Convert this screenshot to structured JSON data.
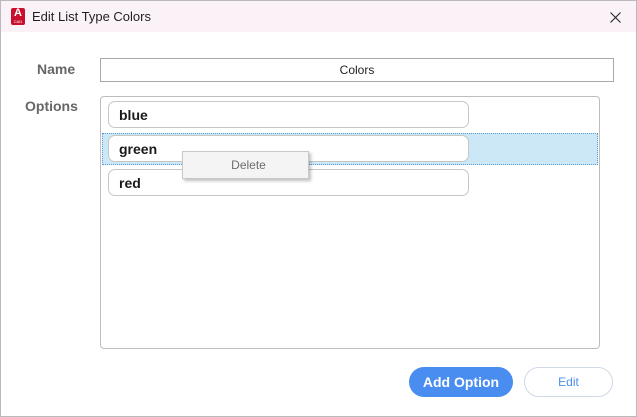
{
  "window": {
    "title": "Edit List Type Colors",
    "app_icon_letter": "A",
    "app_icon_sub": "CAD",
    "accent_color": "#c8102e"
  },
  "form": {
    "name_label": "Name",
    "name_value": "Colors",
    "options_label": "Options"
  },
  "options": [
    {
      "value": "blue",
      "selected": false
    },
    {
      "value": "green",
      "selected": true
    },
    {
      "value": "red",
      "selected": false
    }
  ],
  "context_menu": {
    "items": [
      "Delete"
    ]
  },
  "buttons": {
    "add_option": "Add Option",
    "edit": "Edit",
    "primary_color": "#4a8df0"
  },
  "icons": {
    "close": "close-icon",
    "app": "autocad-app-icon"
  }
}
